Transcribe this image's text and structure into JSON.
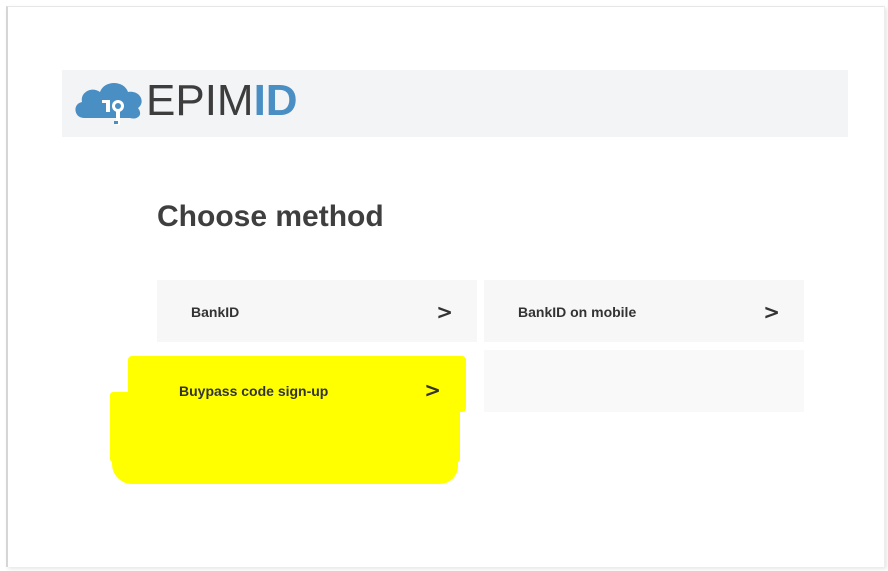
{
  "brand": {
    "name_part1": "EPIM",
    "name_part2": "ID",
    "logo_icon": "cloud-key-icon",
    "colors": {
      "cloud": "#4a8fc4",
      "text": "#3d3d3d",
      "id": "#4a8fc4",
      "highlight": "#ffff00"
    }
  },
  "page": {
    "heading": "Choose method"
  },
  "methods": [
    {
      "label": "BankID",
      "icon": "chevron-right-icon"
    },
    {
      "label": "BankID on mobile",
      "icon": "chevron-right-icon"
    },
    {
      "label": "Buypass code sign-up",
      "icon": "chevron-right-icon",
      "highlighted": true
    }
  ],
  "chevron": ">"
}
